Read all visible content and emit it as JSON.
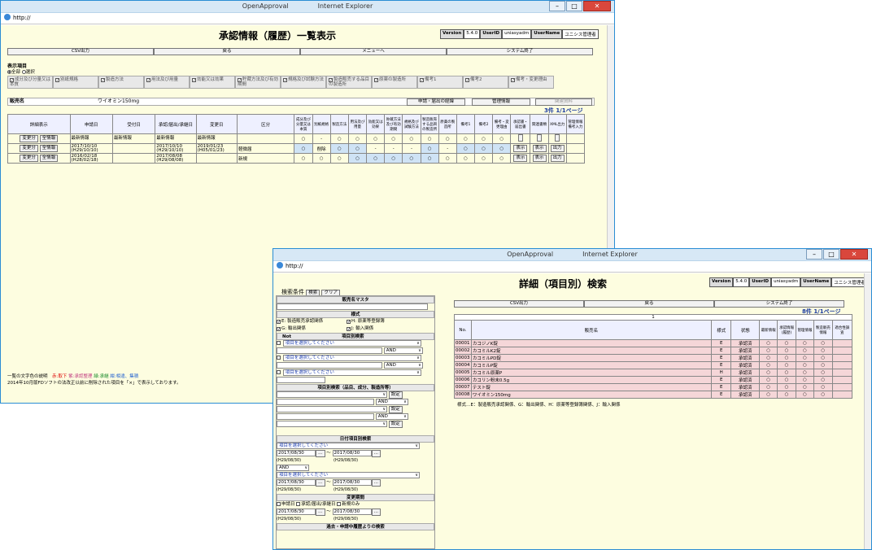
{
  "win1": {
    "title_app": "OpenApproval",
    "title_browser": "Internet Explorer",
    "address": "http://",
    "page_title": "承認情報（履歴）一覧表示",
    "version_label": "Version",
    "version_value": "5.4.0",
    "userid_label": "UserID",
    "userid_value": "uniasyadm",
    "username_label": "UserName",
    "username_value": "ユニシス管理者",
    "buttons": [
      "CSV出力",
      "戻る",
      "メニューへ",
      "システム終了"
    ],
    "display_section": "表示項目",
    "radio_all": "全部",
    "radio_select": "選択",
    "check_items": [
      "成分及び分量又は本質",
      "別紙規格",
      "製造方法",
      "用法及び用量",
      "効能又は効果",
      "貯蔵方法及び有効期間",
      "規格及び試験方法",
      "製造販売する品目の製造所",
      "原薬の製造所",
      "備考1",
      "備考2",
      "備考・変更理由"
    ],
    "product_label": "販売名",
    "product_value": "ワイオミン150mg",
    "btn_history": "申請・届出の経緯",
    "btn_manage": "管理情報",
    "btn_related": "関連資料",
    "count": "3件",
    "page": "1/1ページ",
    "headers": [
      "詳細表示",
      "申請日",
      "受付日",
      "承認/届出/承継日",
      "変更日",
      "区分",
      "成分及び分量又は本質",
      "別紙規格",
      "製造方法",
      "用法及び用量",
      "効能又は効果",
      "貯蔵方法及び有効期間",
      "規格及び試験方法",
      "製造販売する品目の製造所",
      "原薬の製造所",
      "備考1",
      "備考2",
      "備考・変更理由",
      "承認書・届出書",
      "関連書類",
      "XML出力",
      "管理情報備考入力"
    ],
    "rows": [
      {
        "b1": "変更分",
        "b2": "全情報",
        "apply": "最新情報",
        "recv": "最新情報",
        "appr": "最新情報",
        "chg": "最新情報",
        "kubun": "",
        "marks": [
          "○",
          "-",
          "○",
          "○",
          "○",
          "○",
          "○",
          "○",
          "○",
          "○",
          "○",
          "○"
        ],
        "doc": "",
        "rel": "",
        "xml": ""
      },
      {
        "b1": "変更分",
        "b2": "全情報",
        "apply": "2017/10/10 (H29/10/10)",
        "recv": "",
        "appr": "2017/10/10 (H29/10/10)",
        "chg": "2019/01/23 (H05/01/23)",
        "kubun": "軽微届",
        "marks": [
          "○",
          "削除",
          "○",
          "○",
          "-",
          "-",
          "-",
          "○",
          "-",
          "○",
          "○",
          "○"
        ],
        "doc": "表示",
        "rel": "表示",
        "xml": "出力"
      },
      {
        "b1": "変更分",
        "b2": "全情報",
        "apply": "2016/02/18 (H28/02/18)",
        "recv": "",
        "appr": "2017/08/08 (H29/08/08)",
        "chg": "",
        "kubun": "新規",
        "marks": [
          "○",
          "○",
          "○",
          "○",
          "○",
          "○",
          "○",
          "○",
          "○",
          "○",
          "○",
          "○"
        ],
        "doc": "表示",
        "rel": "表示",
        "xml": "出力"
      }
    ],
    "note_line1_a": "一覧の文字色の説明",
    "note_red": "赤:取下",
    "note_pink": "紫:承認整理",
    "note_green": "緑:承継",
    "note_blue": "紺:相違、集積",
    "note_line2": "2014年10月版FDソフトの法改正以前に削除された項目を「×」で表示しております。"
  },
  "win2": {
    "title_app": "OpenApproval",
    "title_browser": "Internet Explorer",
    "address": "http://",
    "page_title": "詳細（項目別）検索",
    "version_label": "Version",
    "version_value": "5.4.0",
    "userid_label": "UserID",
    "userid_value": "uniasyadm",
    "username_label": "UserName",
    "username_value": "ユニシス管理者",
    "search_cond": "検索条件",
    "btn_search": "検索",
    "btn_clear": "クリア",
    "lp_master": "販売名マスタ",
    "lp_style": "様式",
    "style_items": [
      "E: 製造販売承認関係",
      "H: 原薬等登録簿",
      "G: 輸出関係",
      "J: 輸入関係"
    ],
    "lp_not": "Not",
    "lp_item_search": "項目別検索",
    "select_item": "項目を選択してください",
    "and": "AND",
    "lp_item_search2": "項目別検索（品目、成分、製造所等）",
    "btn_set": "設定",
    "lp_date_search": "日付項目別検索",
    "date_from": "2017/08/30",
    "date_from_jp": "(H29/08/30)",
    "tilde": "〜",
    "date_to": "2017/08/30",
    "date_to_jp": "(H29/08/30)",
    "lp_change_period": "変更期間",
    "chk_apply": "申請日",
    "chk_approve": "承認/届出/承継日",
    "chk_new": "新規のみ",
    "lp_past": "過去・申請中履歴よりの検索",
    "buttons": [
      "CSV出力",
      "戻る",
      "システム終了"
    ],
    "count": "8件",
    "page": "1/1ページ",
    "page_no": "1",
    "headers": [
      "No.",
      "販売名",
      "様式",
      "状態",
      "最新情報",
      "承認情報(履歴)",
      "管理情報",
      "製造販売情報",
      "適合性調査"
    ],
    "rows": [
      {
        "no": "00001",
        "name": "カコジノK錠",
        "style": "E",
        "state": "承認済"
      },
      {
        "no": "00002",
        "name": "カコミルK2錠",
        "style": "E",
        "state": "承認済"
      },
      {
        "no": "00003",
        "name": "カコミルPD錠",
        "style": "E",
        "state": "承認済"
      },
      {
        "no": "00004",
        "name": "カコミルP錠",
        "style": "E",
        "state": "承認済"
      },
      {
        "no": "00005",
        "name": "カコミル原薬P",
        "style": "H",
        "state": "承認済"
      },
      {
        "no": "00006",
        "name": "カコリン粉末0.5g",
        "style": "E",
        "state": "承認済"
      },
      {
        "no": "00007",
        "name": "テスト錠",
        "style": "E",
        "state": "承認済"
      },
      {
        "no": "00008",
        "name": "ワイオミン150mg",
        "style": "E",
        "state": "承認済"
      }
    ],
    "circle": "○",
    "style_note": "様式…E：製造販売承認関係、G：輸出関係、H：原薬等登録簿関係、J：輸入関係"
  }
}
